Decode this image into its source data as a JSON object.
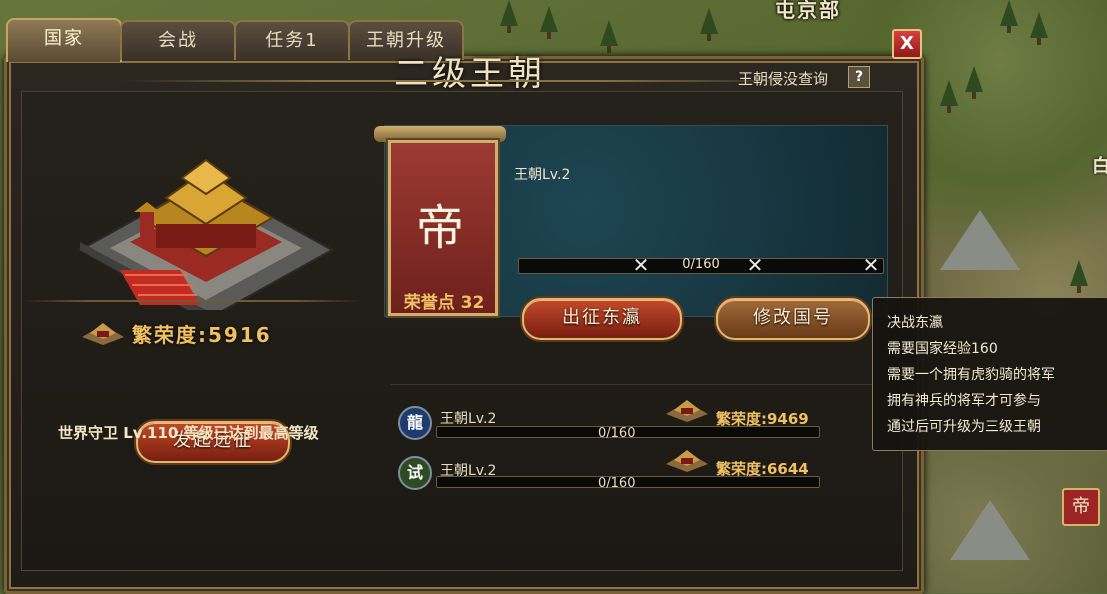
{
  "map": {
    "top_label": "屯京部",
    "right_label": "白",
    "city_flag_char": "帝"
  },
  "tabs": [
    {
      "label": "国家",
      "active": true
    },
    {
      "label": "会战",
      "active": false
    },
    {
      "label": "任务1",
      "active": false
    },
    {
      "label": "王朝升级",
      "active": false
    }
  ],
  "close_label": "X",
  "title": "二级王朝",
  "query": {
    "label": "王朝侵没查询",
    "help": "?"
  },
  "left": {
    "glory_label": "繁荣度:5916",
    "launch_button": "发起远征",
    "world_guard": "世界守卫 Lv.110 等级已达到最高等级"
  },
  "banner": {
    "character": "帝",
    "honor_points": "荣誉点 32"
  },
  "dynasty": {
    "level_label": "王朝Lv.2",
    "progress_text": "0/160",
    "progress_value": 0,
    "progress_max": 160,
    "expedition_button": "出征东瀛",
    "rename_button": "修改国号"
  },
  "tooltip": {
    "lines": [
      "决战东瀛",
      "需要国家经验160",
      "需要一个拥有虎豹骑的将军",
      "拥有神兵的将军才可参与",
      "通过后可升级为三级王朝"
    ]
  },
  "rivals": [
    {
      "badge": "龍",
      "badge_color": "#1e3a6e",
      "level_label": "王朝Lv.2",
      "glory": "繁荣度:9469",
      "progress_text": "0/160",
      "progress_value": 0
    },
    {
      "badge": "试",
      "badge_color": "#2e4a22",
      "level_label": "王朝Lv.2",
      "glory": "繁荣度:6644",
      "progress_text": "0/160",
      "progress_value": 0
    }
  ],
  "colors": {
    "accent_gold": "#f0c062",
    "frame_gold": "#8d7242",
    "button_red": "#c04a2a",
    "banner_red": "#9c3a32"
  }
}
